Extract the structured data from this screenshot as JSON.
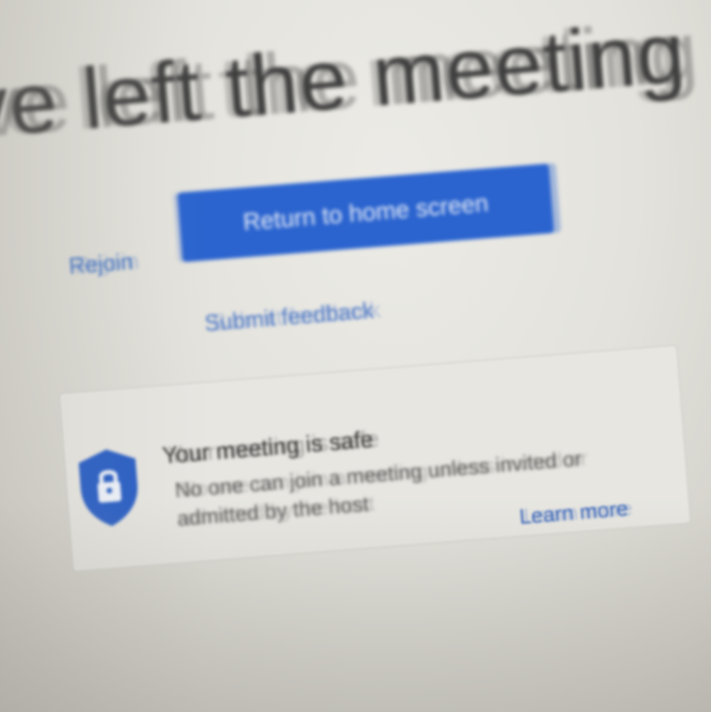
{
  "page": {
    "title": "ve left the meeting"
  },
  "actions": {
    "rejoin_label": "Rejoin",
    "home_button_label": "Return to home screen",
    "feedback_label": "Submit feedback"
  },
  "safety_card": {
    "icon": "shield-lock-icon",
    "title": "Your meeting is safe",
    "body": "No one can join a meeting unless invited or admitted by the host",
    "learn_more_label": "Learn more"
  },
  "colors": {
    "accent": "#2b64cf",
    "link": "#3d6fc4",
    "background": "#e3e2dc"
  }
}
